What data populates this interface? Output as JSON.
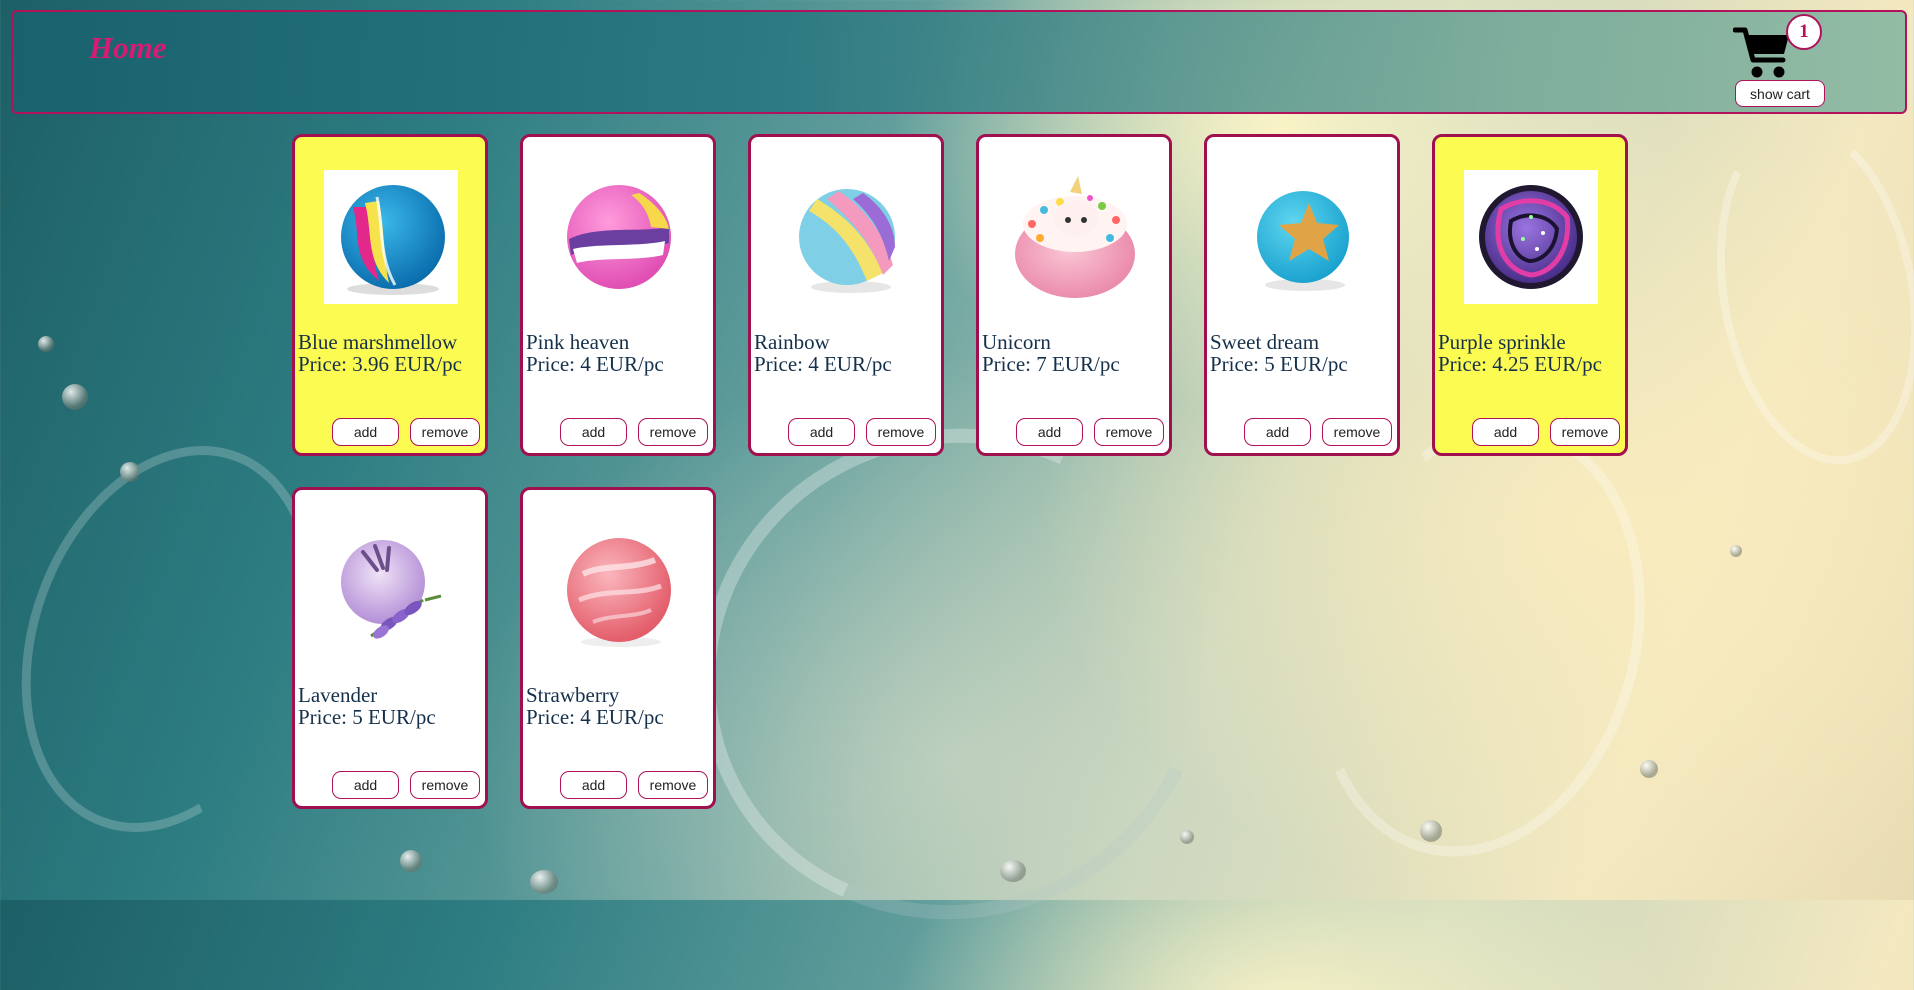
{
  "header": {
    "home_label": "Home",
    "cart_count": "1",
    "show_cart_label": "show cart"
  },
  "products": [
    {
      "name": "Blue marshmellow",
      "price": "Price: 3.96 EUR/pc",
      "selected": true,
      "add_label": "add",
      "remove_label": "remove"
    },
    {
      "name": "Pink heaven",
      "price": "Price: 4 EUR/pc",
      "selected": false,
      "add_label": "add",
      "remove_label": "remove"
    },
    {
      "name": "Rainbow",
      "price": "Price: 4 EUR/pc",
      "selected": false,
      "add_label": "add",
      "remove_label": "remove"
    },
    {
      "name": "Unicorn",
      "price": "Price: 7 EUR/pc",
      "selected": false,
      "add_label": "add",
      "remove_label": "remove"
    },
    {
      "name": "Sweet dream",
      "price": "Price: 5 EUR/pc",
      "selected": false,
      "add_label": "add",
      "remove_label": "remove"
    },
    {
      "name": "Purple sprinkle",
      "price": "Price: 4.25 EUR/pc",
      "selected": true,
      "add_label": "add",
      "remove_label": "remove"
    },
    {
      "name": "Lavender",
      "price": "Price: 5 EUR/pc",
      "selected": false,
      "add_label": "add",
      "remove_label": "remove"
    },
    {
      "name": "Strawberry",
      "price": "Price: 4 EUR/pc",
      "selected": false,
      "add_label": "add",
      "remove_label": "remove"
    }
  ],
  "colors": {
    "accent": "#b0125b",
    "home": "#d81b73",
    "selected_card": "#fcfb52",
    "text": "#15304b"
  }
}
